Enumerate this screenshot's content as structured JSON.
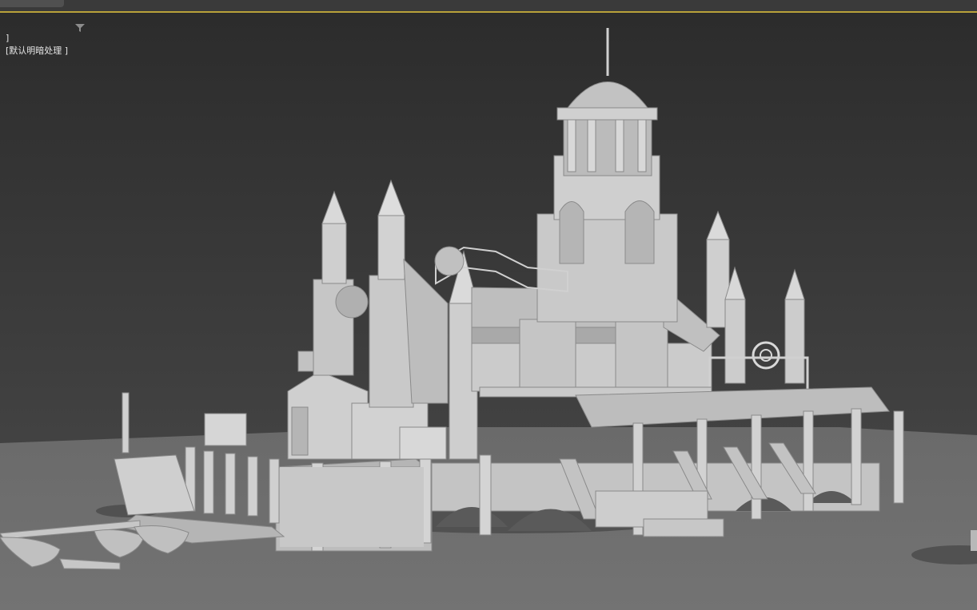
{
  "viewport": {
    "label_bracket_left": "]",
    "shading_mode": "[默认明暗处理 ]",
    "filter_icon": "filter-icon"
  },
  "colors": {
    "background_top": "#2e2e2e",
    "background_bottom": "#4a4a4a",
    "ground": "#6e6e6e",
    "model": "#c9c9c9",
    "topbar_accent": "#b8a13a"
  }
}
